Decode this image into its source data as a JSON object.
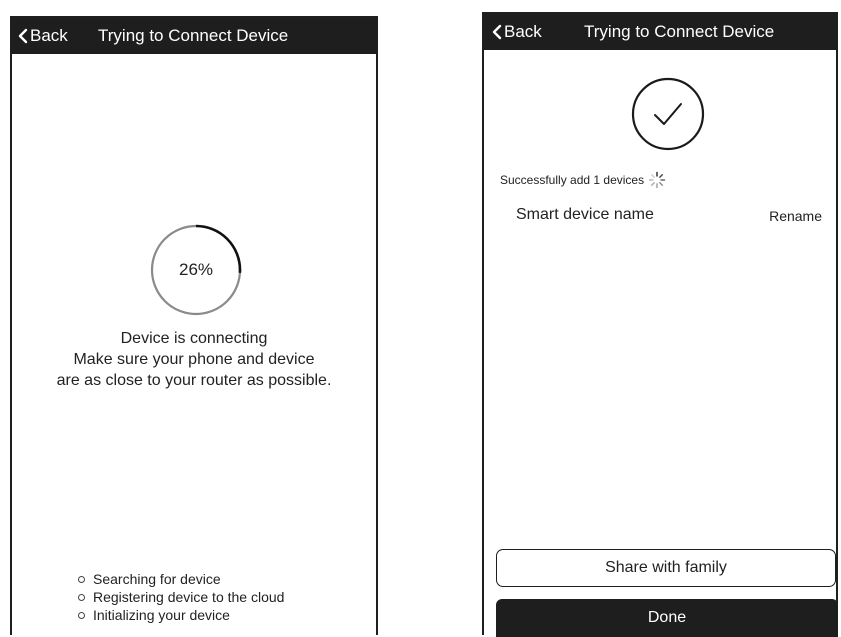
{
  "colors": {
    "nav_bar": "#1e1e1e",
    "nav_text": "#ffffff",
    "ring_track": "#8a8a8a",
    "ring_progress": "#111111",
    "done_button": "#1e1e1e"
  },
  "left_screen": {
    "nav": {
      "back_label": "Back",
      "back_icon": "chevron-left-icon",
      "title": "Trying to Connect Device"
    },
    "progress": {
      "percent_label": "26%",
      "fraction": 0.26
    },
    "status": {
      "line1": "Device is connecting",
      "line2": "Make sure your phone and device",
      "line3": "are as close to your router as possible."
    },
    "steps": [
      "Searching for device",
      "Registering device to the cloud",
      "Initializing your device"
    ]
  },
  "right_screen": {
    "nav": {
      "back_label": "Back",
      "back_icon": "chevron-left-icon",
      "title": "Trying to Connect Device"
    },
    "success_icon": "check-circle-icon",
    "success_text": "Successfully add 1 devices",
    "spinner_icon": "loading-spinner-icon",
    "device": {
      "name": "Smart device name",
      "rename_label": "Rename"
    },
    "share_label": "Share with family",
    "done_label": "Done"
  }
}
